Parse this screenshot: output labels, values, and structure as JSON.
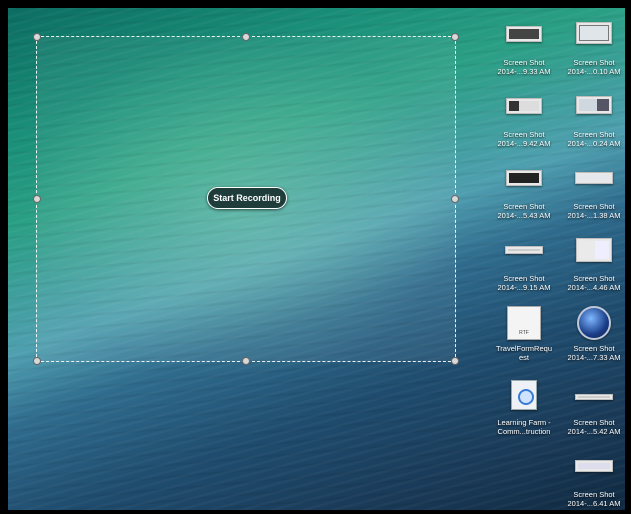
{
  "recorder": {
    "start_label": "Start Recording"
  },
  "desktop": {
    "items": [
      {
        "line1": "Screen Shot",
        "line2": "2014-...9.33 AM",
        "icon": "screenshot-icon"
      },
      {
        "line1": "Screen Shot",
        "line2": "2014-...0.10 AM",
        "icon": "screenshot-icon"
      },
      {
        "line1": "Screen Shot",
        "line2": "2014-...9.42 AM",
        "icon": "screenshot-icon"
      },
      {
        "line1": "Screen Shot",
        "line2": "2014-...0.24 AM",
        "icon": "screenshot-icon"
      },
      {
        "line1": "Screen Shot",
        "line2": "2014-...5.43 AM",
        "icon": "screenshot-icon"
      },
      {
        "line1": "Screen Shot",
        "line2": "2014-...1.38 AM",
        "icon": "screenshot-icon"
      },
      {
        "line1": "Screen Shot",
        "line2": "2014-...9.15 AM",
        "icon": "screenshot-icon"
      },
      {
        "line1": "Screen Shot",
        "line2": "2014-...4.46 AM",
        "icon": "screenshot-icon"
      },
      {
        "line1": "TravelFormRequ",
        "line2": "est",
        "icon": "rtf-document-icon",
        "badge": "RTF"
      },
      {
        "line1": "Screen Shot",
        "line2": "2014-...7.33 AM",
        "icon": "quicktime-icon"
      },
      {
        "line1": "Learning Farm -",
        "line2": "Comm...truction",
        "icon": "ibooks-document-icon"
      },
      {
        "line1": "Screen Shot",
        "line2": "2014-...5.42 AM",
        "icon": "screenshot-icon"
      },
      {
        "line1": "Screen Shot",
        "line2": "2014-...6.41 AM",
        "icon": "screenshot-icon"
      }
    ]
  }
}
